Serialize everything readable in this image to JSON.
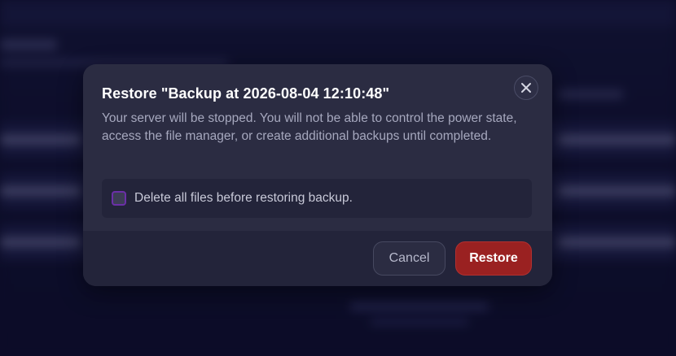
{
  "dialog": {
    "title": "Restore \"Backup at 2026-08-04 12:10:48\"",
    "description": "Your server will be stopped. You will not be able to control the power state, access the file manager, or create additional backups until completed.",
    "option": {
      "label": "Delete all files before restoring backup.",
      "checked": false
    },
    "close_icon": "close-icon",
    "buttons": {
      "cancel": "Cancel",
      "restore": "Restore"
    }
  },
  "colors": {
    "restore_button": "#9a2121",
    "checkbox_border": "#6b2fa8",
    "modal_background": "#2b2c42",
    "footer_background": "#23243a"
  }
}
